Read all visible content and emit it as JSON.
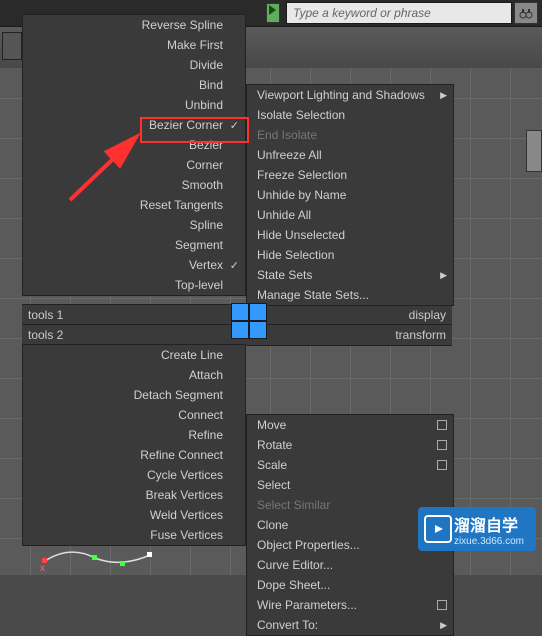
{
  "topbar": {
    "search_placeholder": "Type a keyword or phrase"
  },
  "left_menu": [
    {
      "label": "Reverse Spline"
    },
    {
      "label": "Make First"
    },
    {
      "label": "Divide"
    },
    {
      "label": "Bind"
    },
    {
      "label": "Unbind"
    },
    {
      "label": "Bezier Corner",
      "check": true,
      "highlight": true
    },
    {
      "label": "Bezier"
    },
    {
      "label": "Corner"
    },
    {
      "label": "Smooth"
    },
    {
      "label": "Reset Tangents"
    },
    {
      "label": "Spline"
    },
    {
      "label": "Segment"
    },
    {
      "label": "Vertex",
      "check": true
    },
    {
      "label": "Top-level"
    }
  ],
  "right_menu_top": [
    {
      "label": "Viewport Lighting and Shadows",
      "arrow": true
    },
    {
      "label": "Isolate Selection"
    },
    {
      "label": "End Isolate",
      "disabled": true
    },
    {
      "label": "Unfreeze All"
    },
    {
      "label": "Freeze Selection"
    },
    {
      "label": "Unhide by Name"
    },
    {
      "label": "Unhide All"
    },
    {
      "label": "Hide Unselected"
    },
    {
      "label": "Hide Selection"
    },
    {
      "label": "State Sets",
      "arrow": true
    },
    {
      "label": "Manage State Sets..."
    }
  ],
  "tools1": {
    "left": "tools 1",
    "right": "display"
  },
  "tools2": {
    "left": "tools 2",
    "right": "transform"
  },
  "left_menu2": [
    {
      "label": "Create Line"
    },
    {
      "label": "Attach"
    },
    {
      "label": "Detach Segment"
    },
    {
      "label": "Connect"
    },
    {
      "label": "Refine"
    },
    {
      "label": "Refine Connect"
    },
    {
      "label": "Cycle Vertices"
    },
    {
      "label": "Break Vertices"
    },
    {
      "label": "Weld Vertices"
    },
    {
      "label": "Fuse Vertices"
    }
  ],
  "right_menu2": [
    {
      "label": "Move",
      "sq": true
    },
    {
      "label": "Rotate",
      "sq": true
    },
    {
      "label": "Scale",
      "sq": true
    },
    {
      "label": "Select"
    },
    {
      "label": "Select Similar",
      "disabled": true
    },
    {
      "label": "Clone"
    },
    {
      "label": "Object Properties..."
    },
    {
      "label": "Curve Editor..."
    },
    {
      "label": "Dope Sheet..."
    },
    {
      "label": "Wire Parameters...",
      "sq": true
    },
    {
      "label": "Convert To:",
      "arrow": true
    }
  ],
  "watermark": {
    "title": "溜溜自学",
    "sub": "zixue.3d66.com"
  }
}
